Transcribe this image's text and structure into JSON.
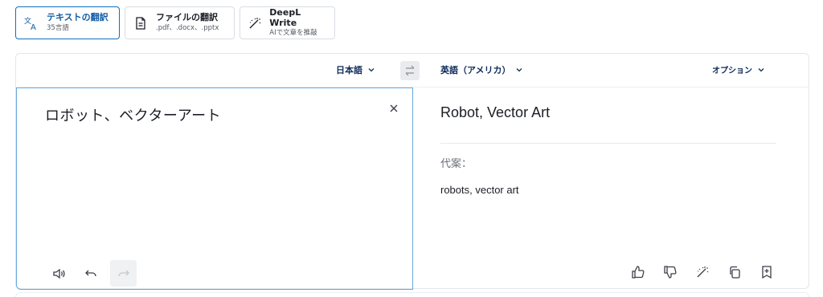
{
  "mode_tabs": [
    {
      "title": "テキストの翻訳",
      "sub": "35言語",
      "icon": "translate-icon",
      "active": true
    },
    {
      "title": "ファイルの翻訳",
      "sub": ".pdf、.docx、.pptx",
      "icon": "document-icon",
      "active": false
    },
    {
      "title": "DeepL Write",
      "sub": "AIで文章を推敲",
      "icon": "magic-wand-icon",
      "active": false
    }
  ],
  "lang_bar": {
    "source_lang": "日本語",
    "target_lang": "英語（アメリカ）",
    "options": "オプション"
  },
  "source": {
    "text": "ロボット、ベクターアート"
  },
  "target": {
    "text": "Robot, Vector Art",
    "alternatives_label": "代案：",
    "alternatives": [
      "robots, vector art"
    ]
  },
  "colors": {
    "accent": "#0f6fbf",
    "source_border": "#6aa8dd",
    "lang_text": "#0f2b5b"
  }
}
